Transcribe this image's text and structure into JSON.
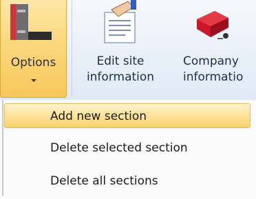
{
  "ribbon": {
    "options": {
      "label": "Options",
      "icon": "layout-panels-icon"
    },
    "edit_site": {
      "line1": "Edit site",
      "line2": "information",
      "icon": "edit-document-icon"
    },
    "company": {
      "line1": "Company",
      "line2": "informatio",
      "icon": "company-device-icon"
    }
  },
  "menu": {
    "items": [
      {
        "label": "Add new section"
      },
      {
        "label": "Delete selected section"
      },
      {
        "label": "Delete all sections"
      }
    ]
  },
  "colors": {
    "highlight": "#fbd77d",
    "ribbon_bg": "#dfe9f5",
    "icon_red": "#c8182a"
  }
}
